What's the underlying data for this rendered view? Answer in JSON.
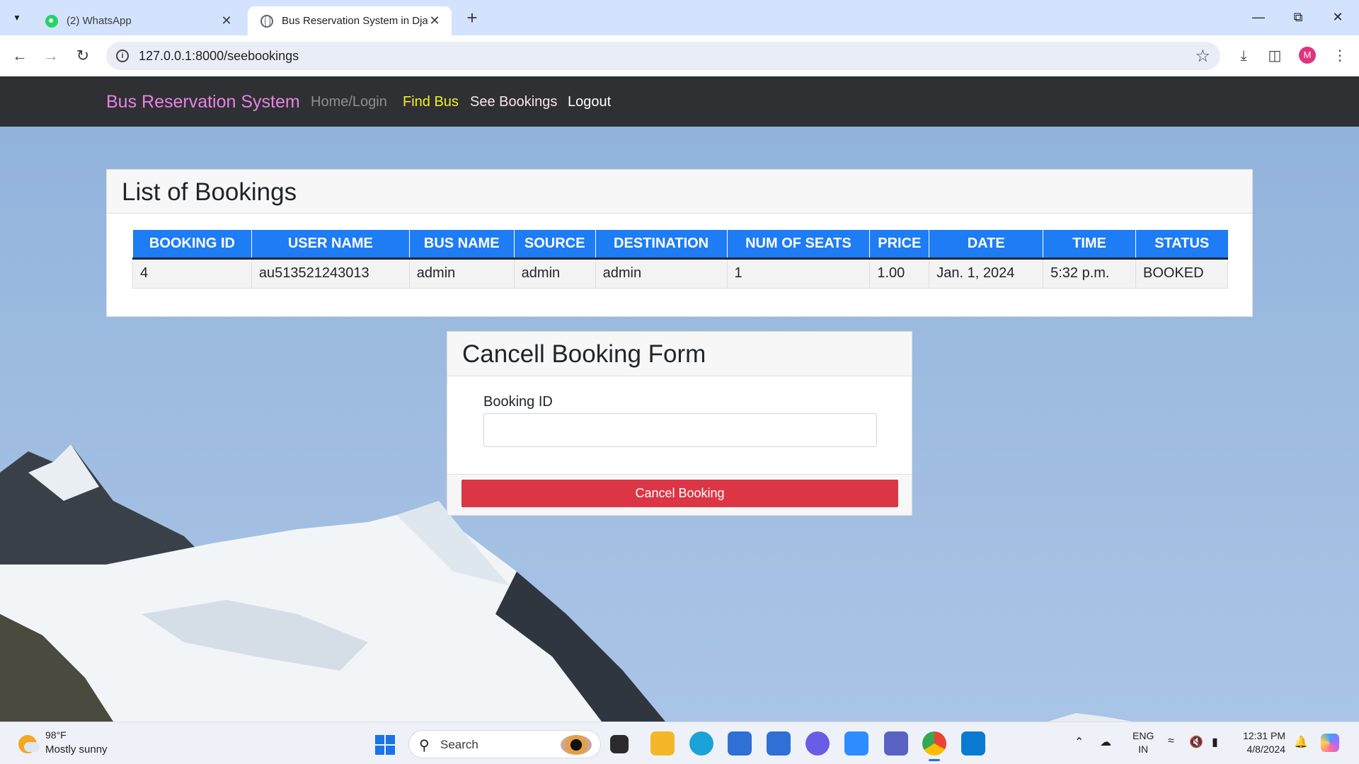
{
  "browser": {
    "tabs": [
      {
        "title": "(2) WhatsApp",
        "icon": "whatsapp-icon"
      },
      {
        "title": "Bus Reservation System in Djan",
        "icon": "globe-icon"
      }
    ],
    "url": "127.0.0.1:8000/seebookings",
    "profile_initial": "M"
  },
  "site": {
    "brand": "Bus Reservation System",
    "nav": {
      "home": "Home/Login",
      "find": "Find Bus",
      "see": "See Bookings",
      "logout": "Logout"
    },
    "colors": {
      "brand": "#e982e3",
      "find": "#f4f01d",
      "table_header": "#1e7cf5",
      "danger": "#dc3545"
    }
  },
  "bookings": {
    "title": "List of Bookings",
    "columns": [
      "BOOKING ID",
      "USER NAME",
      "BUS NAME",
      "SOURCE",
      "DESTINATION",
      "NUM OF SEATS",
      "PRICE",
      "DATE",
      "TIME",
      "STATUS"
    ],
    "rows": [
      [
        "4",
        "au513521243013",
        "admin",
        "admin",
        "admin",
        "1",
        "1.00",
        "Jan. 1, 2024",
        "5:32 p.m.",
        "BOOKED"
      ]
    ]
  },
  "cancel_form": {
    "title": "Cancell Booking Form",
    "field_label": "Booking ID",
    "field_value": "",
    "button": "Cancel Booking"
  },
  "taskbar": {
    "weather_temp": "98°F",
    "weather_desc": "Mostly sunny",
    "search_placeholder": "Search",
    "lang_top": "ENG",
    "lang_bottom": "IN",
    "time": "12:31 PM",
    "date": "4/8/2024"
  }
}
